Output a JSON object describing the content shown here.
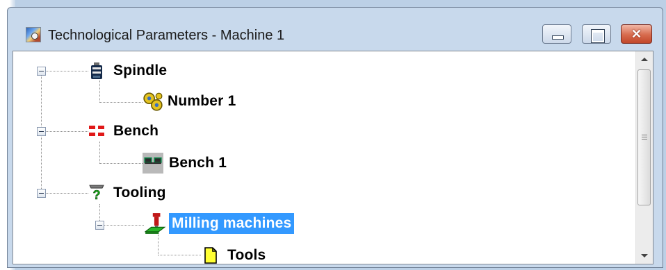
{
  "window": {
    "title": "Technological Parameters - Machine 1",
    "controls": {
      "minimize": "–",
      "maximize": "□",
      "close": "✕"
    }
  },
  "tree": {
    "nodes": [
      {
        "label": "Spindle",
        "icon": "spindle-icon",
        "expanded": true,
        "level": 0
      },
      {
        "label": "Number 1",
        "icon": "gears-icon",
        "level": 1
      },
      {
        "label": "Bench",
        "icon": "bench-icon",
        "expanded": true,
        "level": 0
      },
      {
        "label": "Bench 1",
        "icon": "bench-item-icon",
        "level": 1
      },
      {
        "label": "Tooling",
        "icon": "tooling-icon",
        "expanded": true,
        "level": 0
      },
      {
        "label": "Milling machines",
        "icon": "milling-icon",
        "expanded": true,
        "selected": true,
        "level": 1
      },
      {
        "label": "Tools",
        "icon": "document-icon",
        "level": 2
      }
    ]
  },
  "colors": {
    "selection": "#3399ff",
    "frame": "#c8d9ec",
    "close_button": "#c2472a"
  }
}
